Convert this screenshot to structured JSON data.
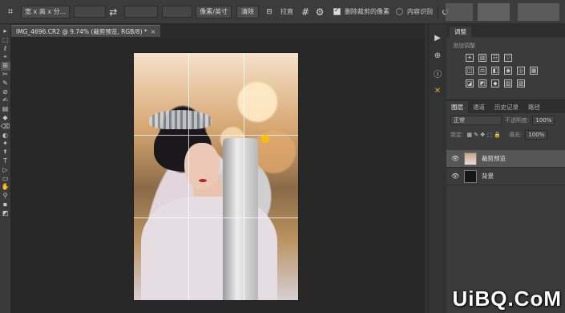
{
  "options_bar": {
    "ratio_select": "宽 x 高 x 分...",
    "unit_select": "像素/英寸",
    "clear_button": "清除",
    "straighten_label": "拉直",
    "delete_cropped_label": "删除裁剪的像素",
    "content_aware_label": "内容识别",
    "swap_icon": "swap-icon",
    "gear_icon": "gear-icon",
    "reset_icon": "reset-icon"
  },
  "document_tab": {
    "title": "IMG_4696.CR2 @ 9.74% (裁剪预览, RGB/8) *",
    "close_label": "×"
  },
  "tools": [
    "▸",
    "⬚",
    "ℓ",
    "⌖",
    "⊞",
    "✂",
    "✎",
    "⊘",
    "✍",
    "▤",
    "◆",
    "⌫",
    "◐",
    "✦",
    "↟",
    "T",
    "▷",
    "▭",
    "✋",
    "⚲",
    "▪",
    "◩"
  ],
  "adjustments": {
    "tab": "调整",
    "subtitle": "添加调整",
    "row1": [
      "☀",
      "▥",
      "☷",
      "▽"
    ],
    "row2": [
      "◫",
      "⚖",
      "◧",
      "◉",
      "◎",
      "▦"
    ],
    "row3": [
      "◪",
      "◩",
      "◆",
      "▨",
      "▧"
    ]
  },
  "layers_panel": {
    "tabs": [
      "图层",
      "通道",
      "历史记录",
      "路径"
    ],
    "blend_mode": "正常",
    "opacity_label": "不透明度:",
    "opacity_value": "100%",
    "lock_label": "锁定:",
    "fill_label": "填充:",
    "fill_value": "100%",
    "layers": [
      {
        "name": "裁剪预览",
        "visible": true,
        "active": true
      },
      {
        "name": "背景",
        "visible": true,
        "active": false
      }
    ]
  },
  "watermark": "UiBQ.CoM"
}
